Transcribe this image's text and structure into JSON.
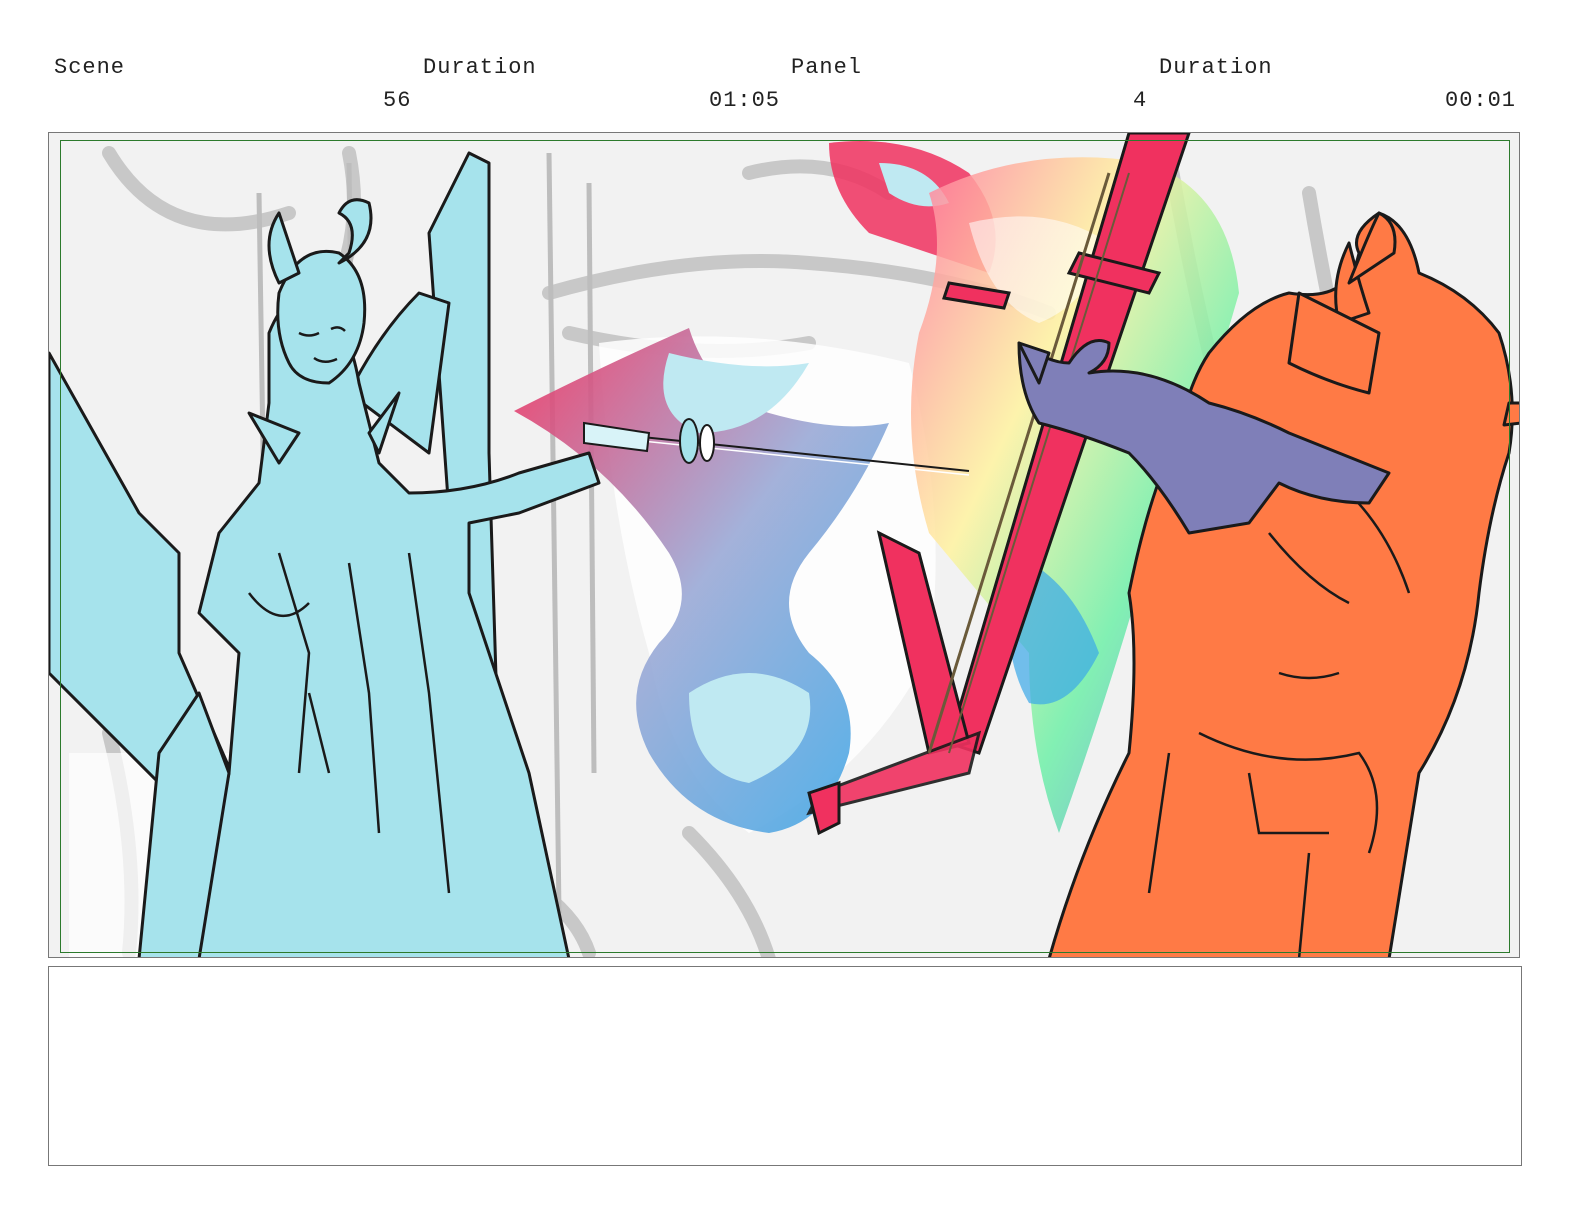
{
  "header": {
    "scene_label": "Scene",
    "scene_duration_label": "Duration",
    "panel_label": "Panel",
    "panel_duration_label": "Duration",
    "scene_number": "56",
    "scene_duration": "01:05",
    "panel_number": "4",
    "panel_duration": "00:01"
  },
  "panel": {
    "image_icon": "storyboard-drawing",
    "colors": {
      "cyan_character": "#a6e3ec",
      "orange_character": "#ff7a45",
      "purple_creature": "#7f7fb8",
      "red_sword": "#f0315f",
      "safe_area_border": "#2c7a2c"
    }
  },
  "notes": {
    "text": ""
  }
}
